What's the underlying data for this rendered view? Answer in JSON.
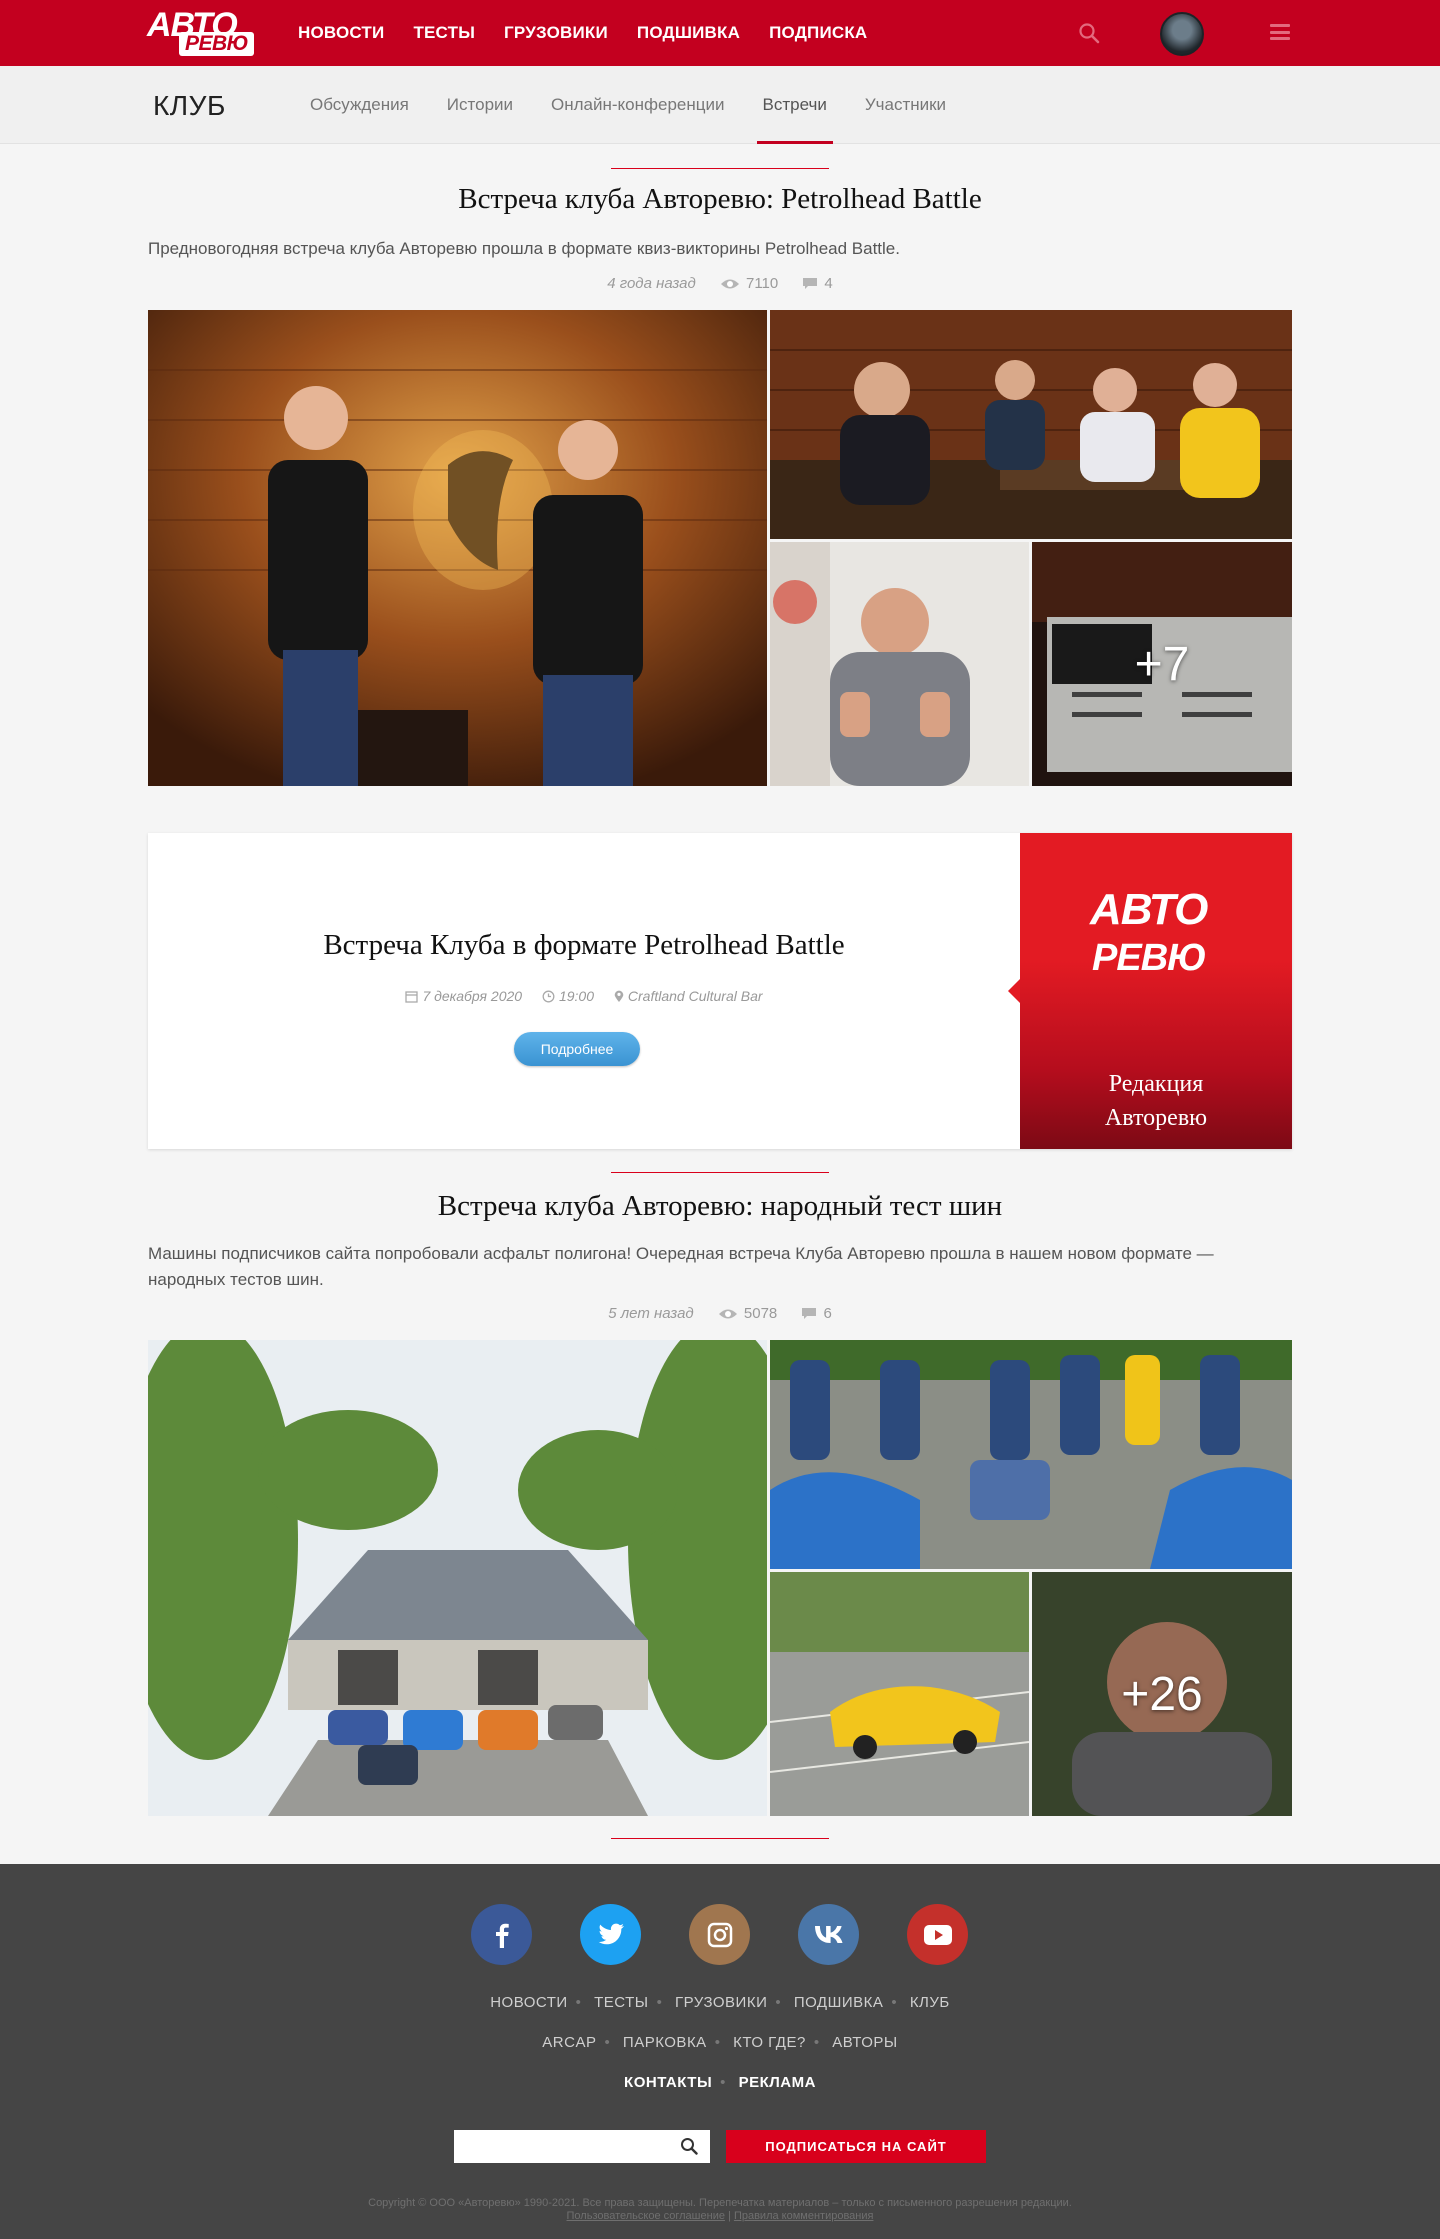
{
  "header": {
    "logo_top": "АВТО",
    "logo_bottom": "РЕВЮ",
    "nav": [
      "НОВОСТИ",
      "ТЕСТЫ",
      "ГРУЗОВИКИ",
      "ПОДШИВКА",
      "ПОДПИСКА"
    ],
    "icons": [
      "search-icon",
      "avatar",
      "menu-icon"
    ]
  },
  "subnav": {
    "title": "КЛУБ",
    "tabs": [
      "Обсуждения",
      "Истории",
      "Онлайн-конференции",
      "Встречи",
      "Участники"
    ],
    "active_tab": "Встречи"
  },
  "articles": [
    {
      "title": "Встреча клуба Авторевю: Petrolhead Battle",
      "lead": "Предновогодняя встреча клуба Авторевю прошла в формате квиз-викторины Petrolhead Battle.",
      "time": "4 года назад",
      "views": "7110",
      "comments": "4",
      "more_photos": "+7"
    },
    {
      "title": "Встреча клуба Авторевю: народный тест шин",
      "lead": "Машины подписчиков сайта попробовали асфальт полигона! Очередная встреча Клуба Авторевю прошла в нашем новом формате — народных тестов шин.",
      "time": "5 лет назад",
      "views": "5078",
      "comments": "6",
      "more_photos": "+26"
    }
  ],
  "event": {
    "title": "Встреча Клуба в формате Petrolhead Battle",
    "date": "7 декабря 2020",
    "time": "19:00",
    "place": "Craftland Cultural Bar",
    "button": "Подробнее",
    "panel_logo_top": "АВТО",
    "panel_logo_bottom": "РЕВЮ",
    "panel_name_1": "Редакция",
    "panel_name_2": "Авторевю"
  },
  "footer": {
    "social": [
      "facebook-icon",
      "twitter-icon",
      "instagram-icon",
      "vk-icon",
      "youtube-icon"
    ],
    "nav_row1": [
      "НОВОСТИ",
      "ТЕСТЫ",
      "ГРУЗОВИКИ",
      "ПОДШИВКА",
      "КЛУБ"
    ],
    "nav_row2": [
      "ARCAP",
      "ПАРКОВКА",
      "КТО ГДЕ?",
      "АВТОРЫ"
    ],
    "nav_row3": [
      "КОНТАКТЫ",
      "РЕКЛАМА"
    ],
    "search_placeholder": "",
    "subscribe": "ПОДПИСАТЬСЯ НА САЙТ",
    "copyright": "Copyright © ООО «Авторевю» 1990-2021. Все права защищены. Перепечатка материалов – только с письменного разрешения редакции.",
    "link_agreement": "Пользовательское соглашение",
    "link_sep": "|",
    "link_rules": "Правила комментирования"
  },
  "colors": {
    "brand_red": "#c3001f",
    "button_blue": "#3a93d2",
    "footer_bg": "#454545",
    "facebook": "#3b5998",
    "twitter": "#1da1f2",
    "instagram": "#a0764f",
    "vk": "#4a76a8",
    "youtube": "#c4302b"
  }
}
